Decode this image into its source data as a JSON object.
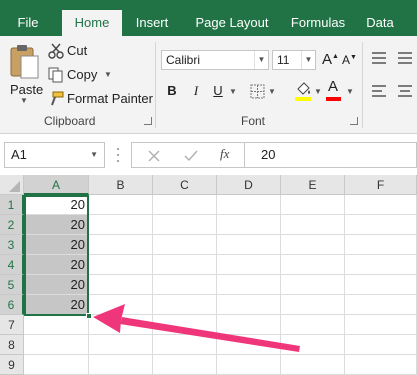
{
  "tabs": {
    "file": "File",
    "home": "Home",
    "insert": "Insert",
    "page_layout": "Page Layout",
    "formulas": "Formulas",
    "data": "Data"
  },
  "clipboard": {
    "paste": "Paste",
    "cut": "Cut",
    "copy": "Copy",
    "format_painter": "Format Painter",
    "group_label": "Clipboard"
  },
  "font": {
    "family": "Calibri",
    "size": "11",
    "grow": "A",
    "shrink": "A",
    "bold": "B",
    "italic": "I",
    "underline": "U",
    "font_color_letter": "A",
    "group_label": "Font",
    "fill_color": "#ffff00",
    "text_color": "#ff0000"
  },
  "formula_bar": {
    "name_box": "A1",
    "fx": "fx",
    "value": "20"
  },
  "sheet": {
    "columns": [
      "A",
      "B",
      "C",
      "D",
      "E",
      "F"
    ],
    "rows": [
      "1",
      "2",
      "3",
      "4",
      "5",
      "6",
      "7",
      "8",
      "9"
    ],
    "cells_a": [
      "20",
      "20",
      "20",
      "20",
      "20",
      "20"
    ],
    "accent": "#217346",
    "annotation_color": "#f0367a"
  }
}
